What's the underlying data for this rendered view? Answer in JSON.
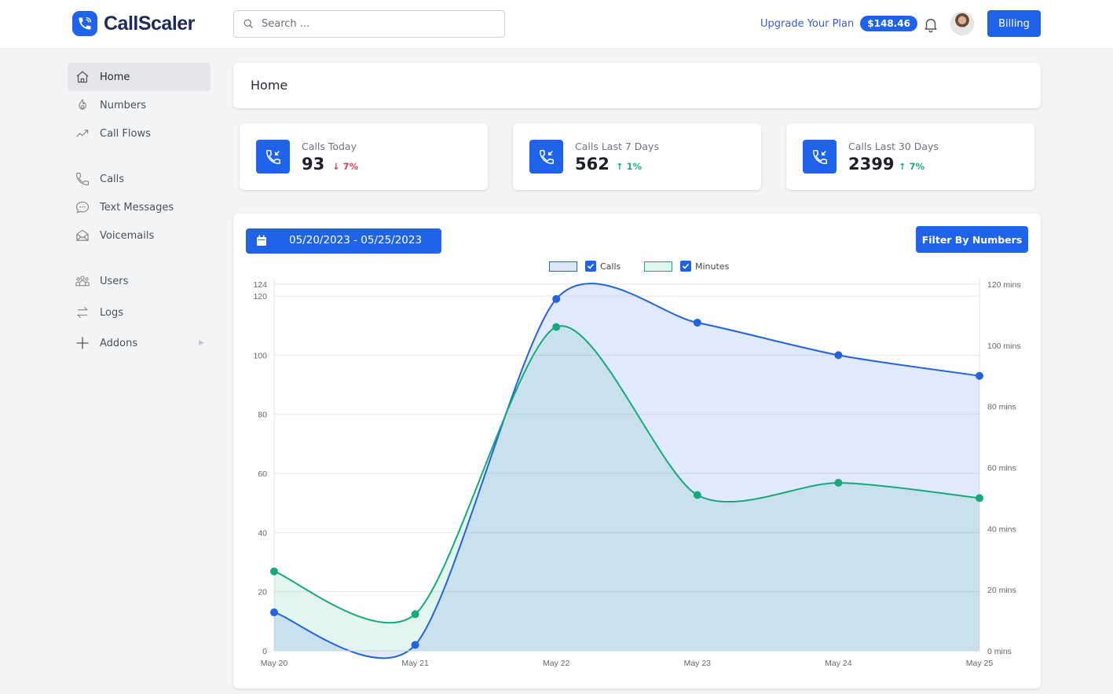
{
  "app": {
    "name": "CallScaler"
  },
  "header": {
    "search_placeholder": "Search ...",
    "upgrade_label": "Upgrade Your Plan",
    "balance": "$148.46",
    "billing_label": "Billing",
    "icons": {
      "search": "search-icon",
      "notifications": "bell-icon",
      "avatar": "user-avatar"
    }
  },
  "sidebar": {
    "items": [
      {
        "label": "Home",
        "icon": "home-icon",
        "active": true
      },
      {
        "label": "Numbers",
        "icon": "numbers-icon"
      },
      {
        "label": "Call Flows",
        "icon": "trending-icon"
      },
      {
        "label": "Calls",
        "icon": "phone-icon"
      },
      {
        "label": "Text Messages",
        "icon": "chat-icon"
      },
      {
        "label": "Voicemails",
        "icon": "envelope-icon"
      },
      {
        "label": "Users",
        "icon": "users-icon"
      },
      {
        "label": "Logs",
        "icon": "swap-icon"
      },
      {
        "label": "Addons",
        "icon": "plus-icon",
        "has_submenu": true
      }
    ]
  },
  "page": {
    "title": "Home"
  },
  "stats": [
    {
      "label": "Calls Today",
      "value": "93",
      "change": "7%",
      "direction": "down"
    },
    {
      "label": "Calls Last 7 Days",
      "value": "562",
      "change": "1%",
      "direction": "up"
    },
    {
      "label": "Calls Last 30 Days",
      "value": "2399",
      "change": "7%",
      "direction": "up"
    }
  ],
  "chart_panel": {
    "date_range": "05/20/2023 - 05/25/2023",
    "filter_label": "Filter By Numbers"
  },
  "colors": {
    "accent": "#1e63ea",
    "calls": "#2463e0",
    "minutes": "#18a97a",
    "down": "#e0444e",
    "up": "#19b17b"
  },
  "chart_data": {
    "type": "area",
    "categories": [
      "May 20",
      "May 21",
      "May 22",
      "May 23",
      "May 24",
      "May 25"
    ],
    "series": [
      {
        "name": "Calls",
        "axis": "left",
        "values": [
          13,
          2,
          119,
          111,
          100,
          93
        ],
        "checked": true
      },
      {
        "name": "Minutes",
        "axis": "right",
        "values": [
          26,
          12,
          106,
          51,
          55,
          50
        ],
        "checked": true
      }
    ],
    "y_left": {
      "ticks": [
        "0",
        "20",
        "40",
        "60",
        "80",
        "100",
        "120",
        "124"
      ],
      "range": [
        0,
        124
      ]
    },
    "y_right": {
      "ticks": [
        "0 mins",
        "20 mins",
        "40 mins",
        "60 mins",
        "80 mins",
        "100 mins",
        "120 mins"
      ],
      "range": [
        0,
        120
      ]
    },
    "grid": true,
    "legend": "top-center",
    "title": "",
    "xlabel": "",
    "ylabel": ""
  }
}
